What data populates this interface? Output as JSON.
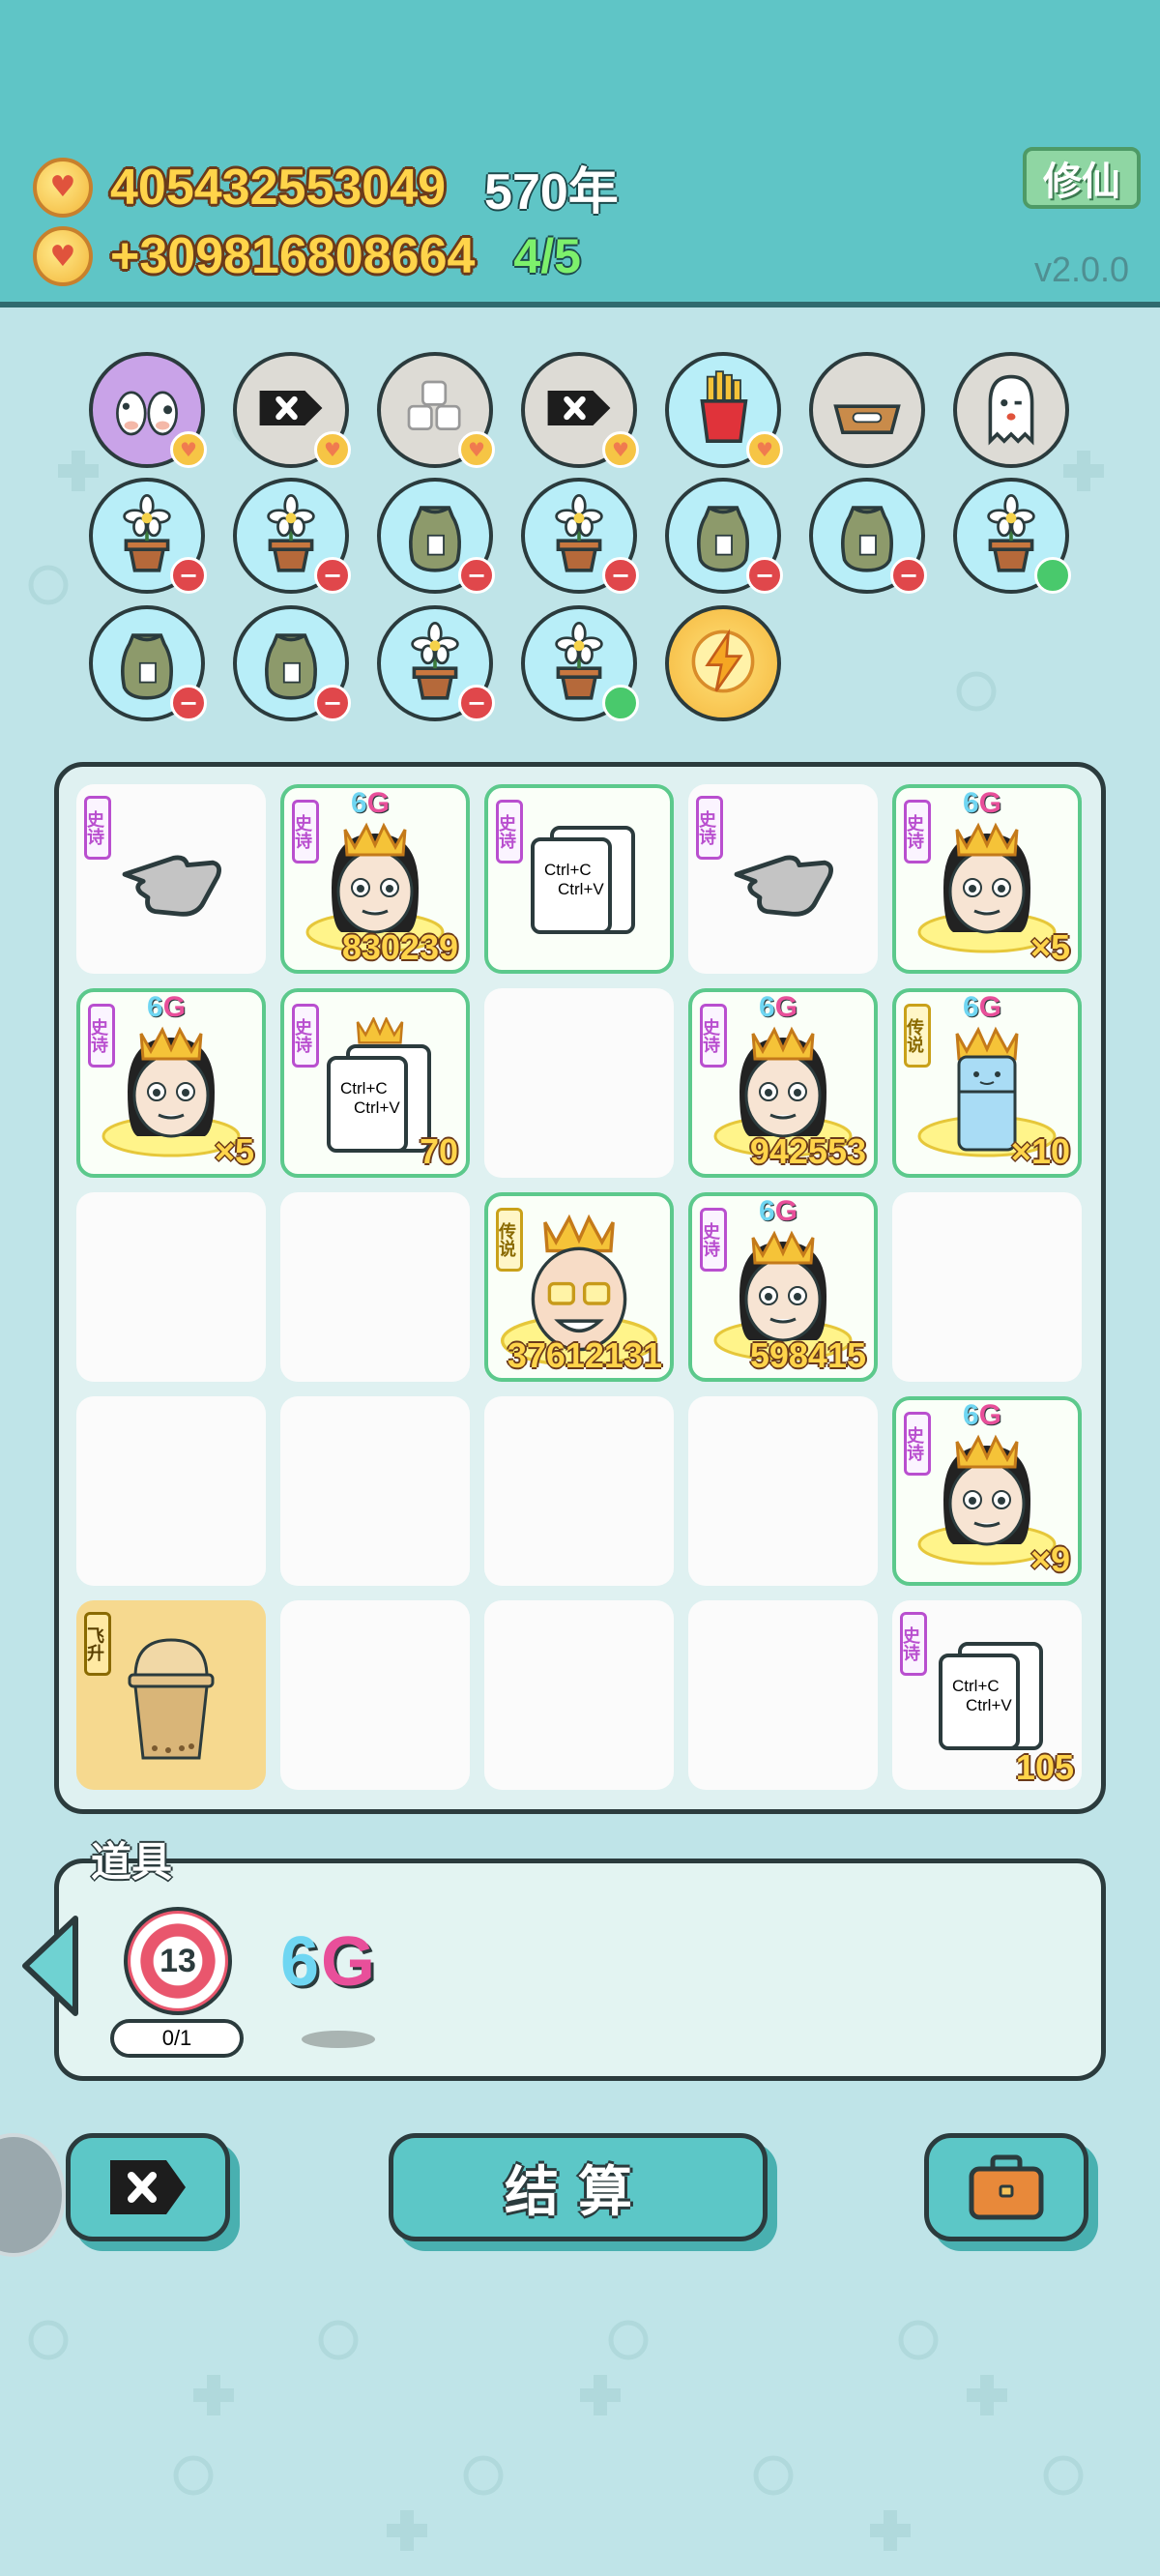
{
  "header": {
    "coins": "405432553049",
    "years": "570年",
    "income": "+309816808664",
    "ratio": "4/5",
    "mode_button": "修仙",
    "version": "v2.0.0"
  },
  "slots": [
    {
      "icon": "cow-pair-icon",
      "badge": "heart"
    },
    {
      "icon": "delete-tag-icon",
      "badge": "heart"
    },
    {
      "icon": "sugar-cubes-icon",
      "badge": "heart"
    },
    {
      "icon": "delete-tag-icon",
      "badge": "heart"
    },
    {
      "icon": "fries-icon",
      "badge": "heart"
    },
    {
      "icon": "pet-bowl-icon",
      "badge": "none"
    },
    {
      "icon": "ghost-icon",
      "badge": "none"
    },
    {
      "icon": "flower-pot-icon",
      "badge": "minus"
    },
    {
      "icon": "flower-pot-icon",
      "badge": "minus"
    },
    {
      "icon": "seed-bag-icon",
      "badge": "minus"
    },
    {
      "icon": "flower-pot-icon",
      "badge": "minus"
    },
    {
      "icon": "seed-bag-icon",
      "badge": "minus"
    },
    {
      "icon": "seed-bag-icon",
      "badge": "minus"
    },
    {
      "icon": "flower-pot-icon",
      "badge": "green"
    },
    {
      "icon": "seed-bag-icon",
      "badge": "minus"
    },
    {
      "icon": "seed-bag-icon",
      "badge": "minus"
    },
    {
      "icon": "flower-pot-icon",
      "badge": "minus"
    },
    {
      "icon": "flower-pot-icon",
      "badge": "green"
    },
    {
      "icon": "lightning-icon",
      "badge": "none"
    }
  ],
  "board": {
    "cells": [
      {
        "tag": "史诗",
        "icon": "pointing-hand-icon",
        "value": ""
      },
      {
        "tag": "史诗",
        "icon": "king-6g-icon",
        "value": "830239"
      },
      {
        "tag": "史诗",
        "icon": "ctrl-cv-icon",
        "value": ""
      },
      {
        "tag": "史诗",
        "icon": "pointing-hand-icon",
        "value": ""
      },
      {
        "tag": "史诗",
        "icon": "king-6g-icon",
        "value": "×5"
      },
      {
        "tag": "史诗",
        "icon": "king-6g-icon",
        "value": "×5"
      },
      {
        "tag": "史诗",
        "icon": "crown-ctrl-cv-icon",
        "value": "70"
      },
      {
        "tag": "",
        "icon": "",
        "value": ""
      },
      {
        "tag": "史诗",
        "icon": "king-6g-icon",
        "value": "942553"
      },
      {
        "tag": "传说",
        "icon": "fridge-6g-icon",
        "value": "×10"
      },
      {
        "tag": "",
        "icon": "",
        "value": ""
      },
      {
        "tag": "",
        "icon": "",
        "value": ""
      },
      {
        "tag": "传说",
        "icon": "old-man-icon",
        "value": "37612131"
      },
      {
        "tag": "史诗",
        "icon": "king-6g-icon",
        "value": "598415"
      },
      {
        "tag": "",
        "icon": "",
        "value": ""
      },
      {
        "tag": "",
        "icon": "",
        "value": ""
      },
      {
        "tag": "",
        "icon": "",
        "value": ""
      },
      {
        "tag": "",
        "icon": "",
        "value": ""
      },
      {
        "tag": "",
        "icon": "",
        "value": ""
      },
      {
        "tag": "史诗",
        "icon": "king-6g-icon",
        "value": "×9"
      },
      {
        "tag": "飞升",
        "icon": "milk-tea-cup-icon",
        "value": ""
      },
      {
        "tag": "",
        "icon": "",
        "value": ""
      },
      {
        "tag": "",
        "icon": "",
        "value": ""
      },
      {
        "tag": "",
        "icon": "",
        "value": ""
      },
      {
        "tag": "史诗",
        "icon": "ctrl-cv-icon",
        "value": "105"
      }
    ],
    "ctrl_c": "Ctrl+C",
    "ctrl_v": "Ctrl+V",
    "sixg": "6G"
  },
  "props": {
    "title": "道具",
    "target_number": "13",
    "target_count": "0/1",
    "sixg_label": "6G"
  },
  "bottom": {
    "settle_label": "结算"
  },
  "colors": {
    "header_bg": "#5fc5c6",
    "body_bg": "#bfe4e8",
    "gold_number": "#ffd44a",
    "epic_tag": "#b94fcf",
    "legend_tag": "#c9a11a",
    "item_border": "#5cc98c",
    "button_bg": "#5cc7c7"
  }
}
